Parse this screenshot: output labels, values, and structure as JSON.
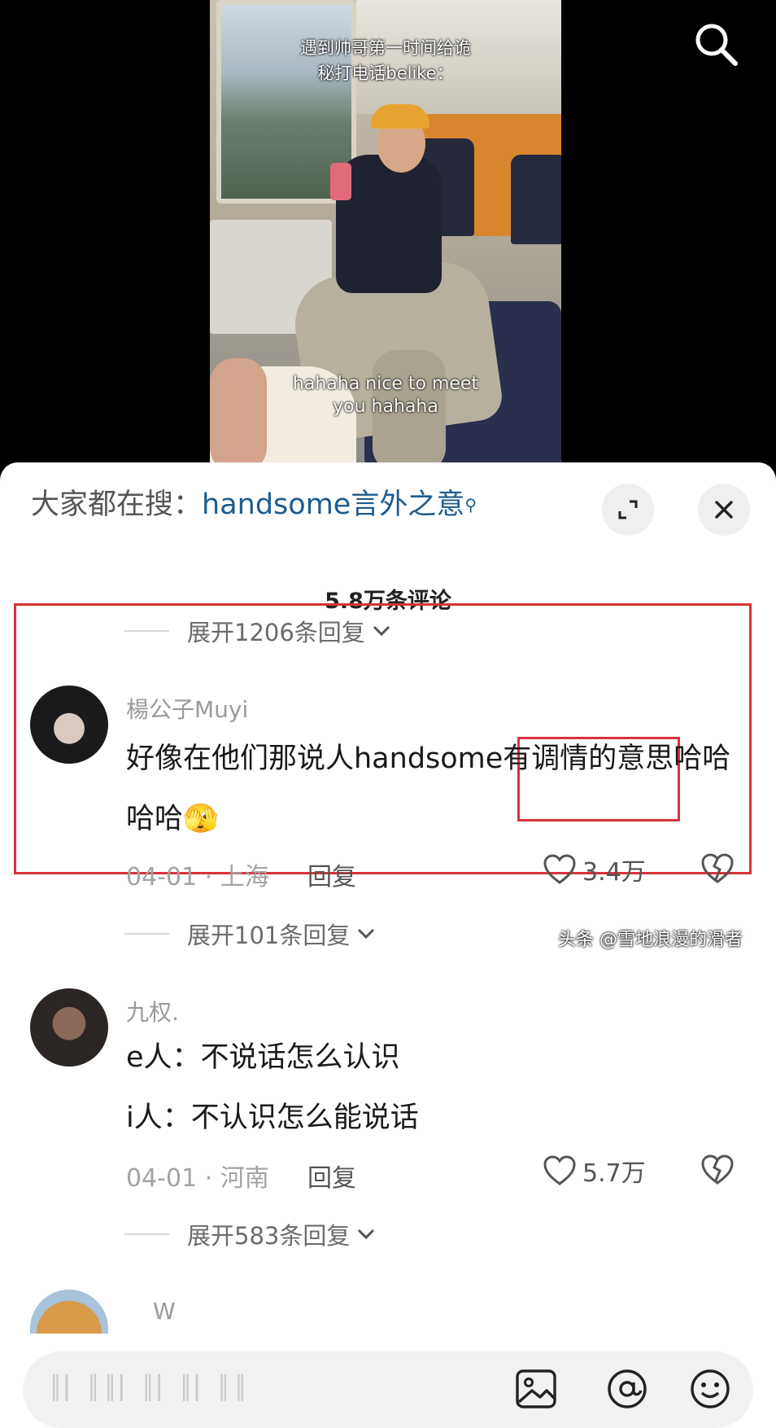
{
  "video": {
    "caption_top_line1": "遇到帅哥第一时间给诡",
    "caption_top_line2": "秘打电话belike：",
    "caption_bottom_line1": "hahaha nice to meet",
    "caption_bottom_line2": "you hahaha",
    "search_icon": "search-icon"
  },
  "sheet": {
    "hot_search_label": "大家都在搜：",
    "hot_search_keyword": "handsome言外之意",
    "comment_count": "5.8万条评论",
    "expand_prev": "展开1206条回复"
  },
  "comments": [
    {
      "username": "楊公子Muyi",
      "text": "好像在他们那说人handsome有调情的意思哈哈哈哈",
      "emoji": "🫣",
      "date_location": "04-01 · 上海",
      "reply_label": "回复",
      "likes": "3.4万",
      "expand": "展开101条回复"
    },
    {
      "username": "九权.",
      "text_line1": "e人：不说话怎么认识",
      "text_line2": "i人：不认识怎么能说话",
      "date_location": "04-01 · 河南",
      "reply_label": "回复",
      "likes": "5.7万",
      "expand": "展开583条回复"
    },
    {
      "username": "W"
    }
  ],
  "input": {
    "placeholder": "║▏║║▏║▏║▏║║"
  },
  "watermark": "头条 @雪地浪漫的滑者",
  "colors": {
    "highlight": "#d8323a",
    "keyword": "#1d5c8f"
  }
}
